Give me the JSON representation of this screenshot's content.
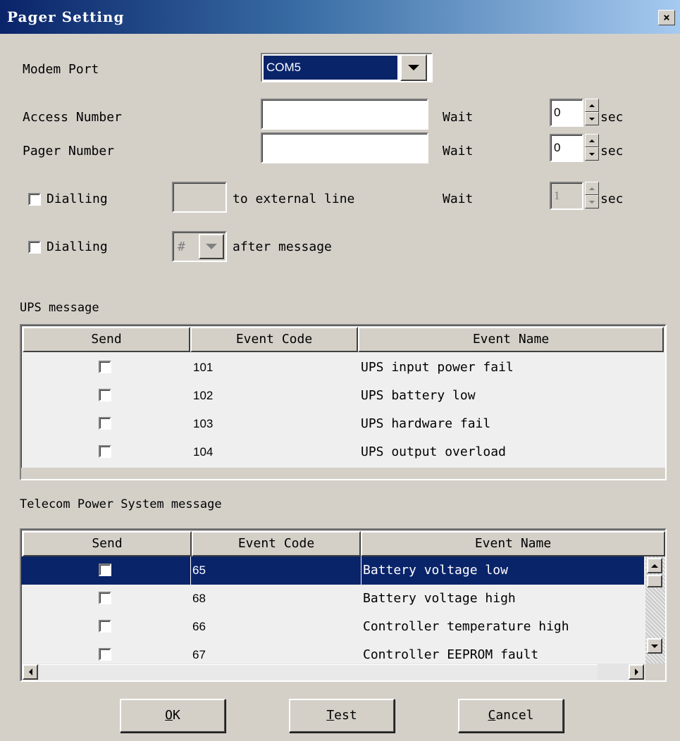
{
  "window": {
    "title": "Pager Setting",
    "close_glyph": "×"
  },
  "modem_port": {
    "label": "Modem Port",
    "value": "COM5"
  },
  "access_number": {
    "label": "Access Number",
    "value": "",
    "wait_label": "Wait",
    "wait_value": "0",
    "unit": "sec"
  },
  "pager_number": {
    "label": "Pager Number",
    "value": "",
    "wait_label": "Wait",
    "wait_value": "0",
    "unit": "sec"
  },
  "dialling_external": {
    "label": "Dialling",
    "checked": false,
    "value": "",
    "suffix": "to external line",
    "wait_label": "Wait",
    "wait_value": "1",
    "unit": "sec"
  },
  "dialling_after": {
    "label": "Dialling",
    "checked": false,
    "value": "#",
    "suffix": "after message"
  },
  "ups": {
    "section_label": "UPS message",
    "headers": [
      "Send",
      "Event Code",
      "Event Name"
    ],
    "rows": [
      {
        "send": false,
        "code": "101",
        "name": "UPS input power fail"
      },
      {
        "send": false,
        "code": "102",
        "name": "UPS battery low"
      },
      {
        "send": false,
        "code": "103",
        "name": "UPS hardware fail"
      },
      {
        "send": false,
        "code": "104",
        "name": "UPS output overload"
      }
    ]
  },
  "telecom": {
    "section_label": "Telecom Power System message",
    "headers": [
      "Send",
      "Event Code",
      "Event Name"
    ],
    "rows": [
      {
        "send": false,
        "code": "65",
        "name": "Battery voltage low",
        "selected": true
      },
      {
        "send": false,
        "code": "68",
        "name": "Battery voltage high"
      },
      {
        "send": false,
        "code": "66",
        "name": "Controller temperature high"
      },
      {
        "send": false,
        "code": "67",
        "name": "Controller EEPROM fault"
      }
    ]
  },
  "buttons": {
    "ok": {
      "mnemonic": "O",
      "rest": "K"
    },
    "test": {
      "mnemonic": "T",
      "rest": "est"
    },
    "cancel": {
      "mnemonic": "C",
      "rest": "ancel"
    }
  },
  "colors": {
    "window_bg": "#d4d0c8",
    "title_bar": "#0a246a",
    "selection": "#0a246a"
  }
}
